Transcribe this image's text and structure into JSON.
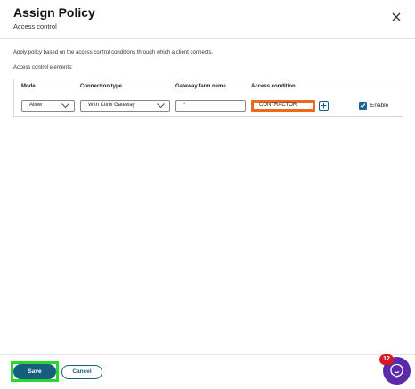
{
  "header": {
    "title": "Assign Policy",
    "subtitle": "Access control"
  },
  "body": {
    "description": "Apply policy based on the access control conditions through which a client connects.",
    "elements_label": "Access control elements:"
  },
  "table": {
    "headers": {
      "mode": "Mode",
      "connection_type": "Connection type",
      "gateway_farm_name": "Gateway farm name",
      "access_condition": "Access condition"
    },
    "row": {
      "mode": "Allow",
      "connection_type": "With Citrix Gateway",
      "gateway_farm_name": "*",
      "access_condition": "CONTRACTOR",
      "enable_label": "Enable",
      "enable_checked": true
    }
  },
  "footer": {
    "save_label": "Save",
    "cancel_label": "Cancel"
  },
  "assistant": {
    "badge_count": "12"
  },
  "colors": {
    "primary": "#155e7e",
    "highlight_orange": "#ec6b1a",
    "highlight_green": "#27d82d",
    "badge_red": "#d51a23",
    "assistant_purple": "#5b2ba9"
  },
  "icons": [
    "close-icon",
    "chevron-down-icon",
    "plus-icon",
    "checkmark-icon",
    "assistant-icon"
  ]
}
